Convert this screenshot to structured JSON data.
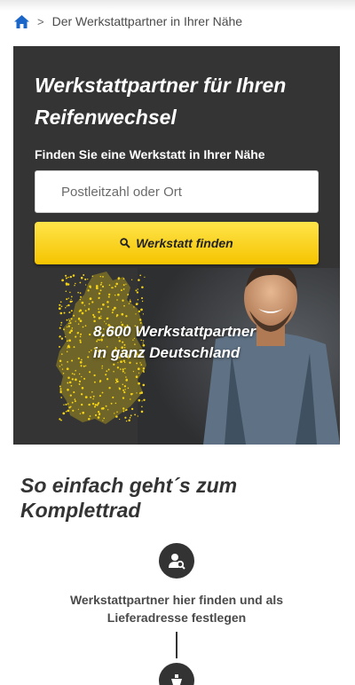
{
  "breadcrumb": {
    "home_icon": "home-icon",
    "separator": ">",
    "current": "Der Werkstattpartner in Ihrer Nähe"
  },
  "hero": {
    "title": "Werkstattpartner für Ihren Reifenwechsel",
    "subtitle": "Finden Sie eine Werkstatt in Ihrer Nähe",
    "search": {
      "placeholder": "Postleitzahl oder Ort",
      "value": ""
    },
    "find_button": {
      "icon": "search-icon",
      "label": "Werkstatt finden"
    },
    "stat_line1": "8.600 Werkstattpartner",
    "stat_line2": "in ganz Deutschland"
  },
  "steps_section": {
    "title": "So einfach geht´s zum Komplettrad",
    "steps": [
      {
        "icon": "search-location-icon",
        "text": "Werkstattpartner hier finden und als Lieferadresse festlegen"
      },
      {
        "icon": "delivery-icon",
        "text": ""
      }
    ]
  },
  "colors": {
    "brand_yellow": "#f5c400",
    "hero_background": "#343434",
    "link_blue": "#1b67c9",
    "text_dark": "#333333"
  }
}
